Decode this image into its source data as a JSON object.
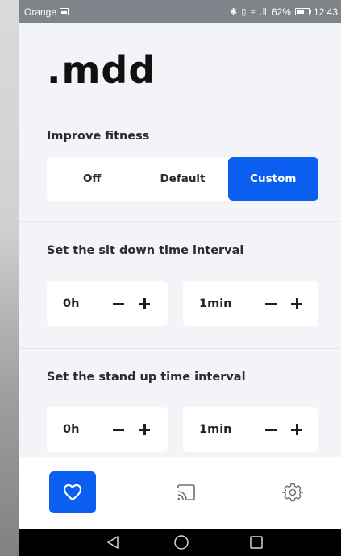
{
  "status_bar": {
    "carrier": "Orange",
    "right_icons_text": "✱ ▯ ≈ .Ⅱ",
    "battery_percent": "62%",
    "battery_level": 0.62,
    "time": "12:43"
  },
  "app": {
    "logo": ".mdd"
  },
  "fitness": {
    "label": "Improve fitness",
    "options": [
      "Off",
      "Default",
      "Custom"
    ],
    "selected": "Custom"
  },
  "sit_down": {
    "label": "Set the sit down time interval",
    "hours_value": "0h",
    "minutes_value": "1min"
  },
  "stand_up": {
    "label": "Set the stand up time interval",
    "hours_value": "0h",
    "minutes_value": "1min"
  },
  "tabs": [
    {
      "icon": "heart-icon",
      "active": true
    },
    {
      "icon": "cast-icon",
      "active": false
    },
    {
      "icon": "settings-gear-icon",
      "active": false
    }
  ],
  "nav_buttons": [
    "back-icon",
    "home-icon",
    "recents-icon"
  ],
  "colors": {
    "accent": "#0a5ef0",
    "background": "#f3f4f8",
    "card": "#ffffff",
    "status_bar": "#808389",
    "nav_bar": "#000000"
  }
}
